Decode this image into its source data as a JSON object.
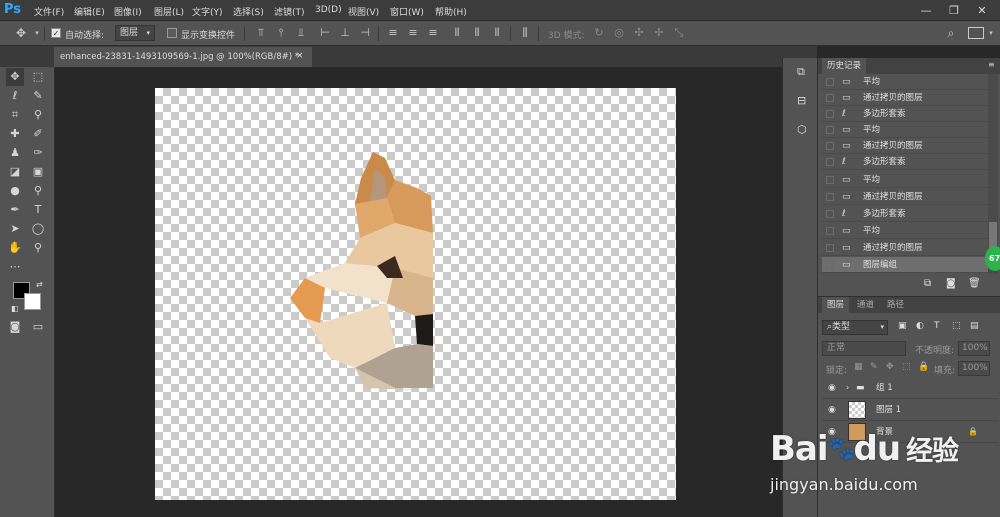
{
  "app": {
    "logo": "Ps"
  },
  "menu": [
    {
      "label": "文件(F)"
    },
    {
      "label": "编辑(E)"
    },
    {
      "label": "图像(I)"
    },
    {
      "label": "图层(L)"
    },
    {
      "label": "文字(Y)"
    },
    {
      "label": "选择(S)"
    },
    {
      "label": "滤镜(T)"
    },
    {
      "label": "3D(D)"
    },
    {
      "label": "视图(V)"
    },
    {
      "label": "窗口(W)"
    },
    {
      "label": "帮助(H)"
    }
  ],
  "window_controls": {
    "minimize": "—",
    "maximize": "❐",
    "close": "✕"
  },
  "options": {
    "auto_select_label": "自动选择:",
    "auto_select_value": "图层",
    "show_transform_label": "显示变换控件",
    "mode_3d_label": "3D 模式:"
  },
  "document": {
    "tab_title": "enhanced-23831-1493109569-1.jpg @ 100%(RGB/8#) *"
  },
  "history": {
    "panel_title": "历史记录",
    "items": [
      {
        "label": "平均",
        "icon": "doc"
      },
      {
        "label": "通过拷贝的图层",
        "icon": "doc"
      },
      {
        "label": "多边形套索",
        "icon": "lasso"
      },
      {
        "label": "平均",
        "icon": "doc"
      },
      {
        "label": "通过拷贝的图层",
        "icon": "doc"
      },
      {
        "label": "多边形套索",
        "icon": "lasso"
      },
      {
        "label": "平均",
        "icon": "doc"
      },
      {
        "label": "通过拷贝的图层",
        "icon": "doc"
      },
      {
        "label": "多边形套索",
        "icon": "lasso"
      },
      {
        "label": "平均",
        "icon": "doc"
      },
      {
        "label": "通过拷贝的图层",
        "icon": "doc"
      },
      {
        "label": "图层编组",
        "icon": "doc"
      }
    ]
  },
  "badge": {
    "value": "67"
  },
  "layers": {
    "tabs": [
      {
        "label": "图层"
      },
      {
        "label": "通道"
      },
      {
        "label": "路径"
      }
    ],
    "filter_kind": "类型",
    "blend_mode": "正常",
    "opacity_label": "不透明度:",
    "opacity_value": "100%",
    "lock_label": "锁定:",
    "fill_label": "填充:",
    "fill_value": "100%",
    "items": [
      {
        "name": "组 1",
        "type": "group"
      },
      {
        "name": "图层 1",
        "type": "layer"
      },
      {
        "name": "背景",
        "type": "background"
      }
    ]
  },
  "watermark": {
    "brand": "Bai",
    "brand2": "du",
    "cn": "经验",
    "url": "jingyan.baidu.com"
  },
  "colors": {
    "accent": "#31a8ff",
    "panel": "#535353",
    "canvas_bg": "#282828",
    "badge": "#2bb34a"
  }
}
